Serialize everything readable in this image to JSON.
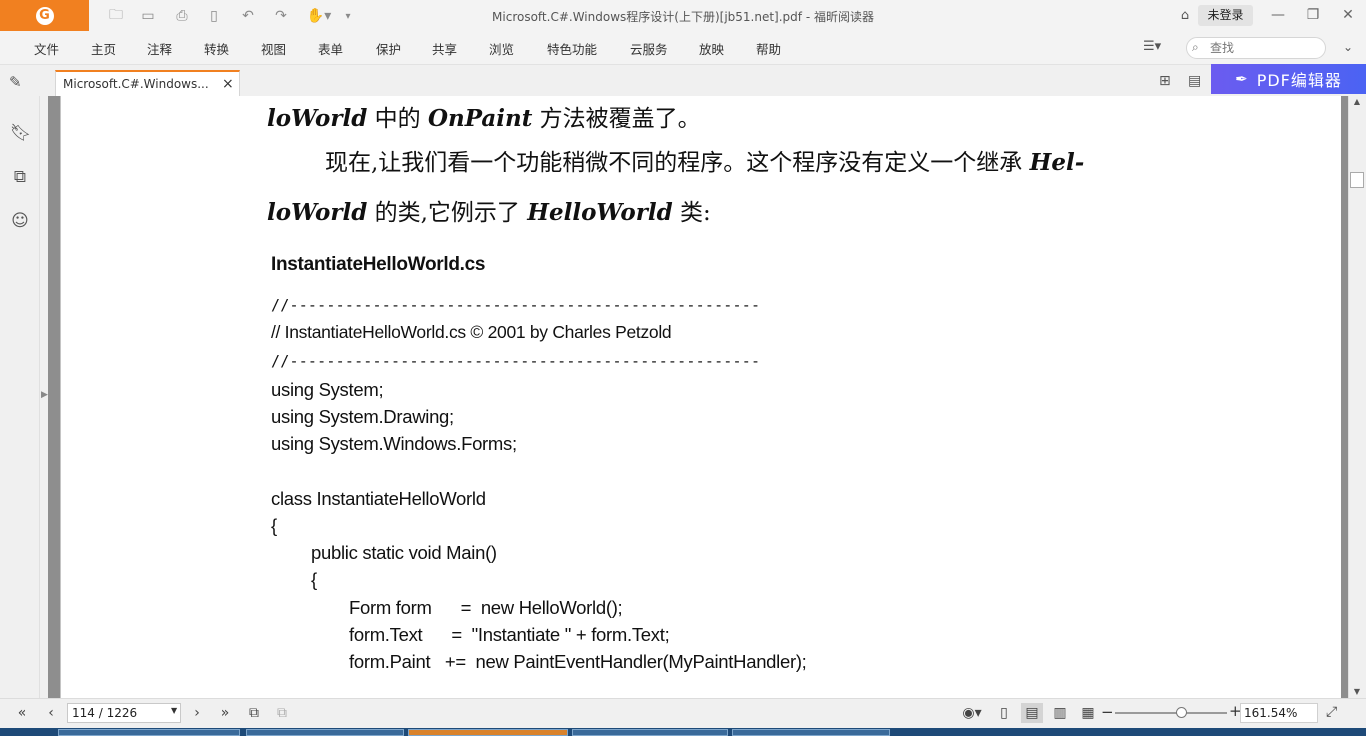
{
  "window": {
    "title": "Microsoft.C#.Windows程序设计(上下册)[jb51.net].pdf - 福昕阅读器",
    "login_label": "未登录"
  },
  "logo": {
    "letter": "G"
  },
  "menu": {
    "items": [
      "文件",
      "主页",
      "注释",
      "转换",
      "视图",
      "表单",
      "保护",
      "共享",
      "浏览",
      "特色功能",
      "云服务",
      "放映",
      "帮助"
    ]
  },
  "search": {
    "placeholder": "查找"
  },
  "tab": {
    "label": "Microsoft.C#.Windows...",
    "close": "×"
  },
  "banner": {
    "label": "PDF编辑器"
  },
  "page": {
    "line1_a": "loWorld",
    "line1_b": " 中的 ",
    "line1_c": "OnPaint",
    "line1_d": " 方法被覆盖了。",
    "line2_a": "现在,让我们看一个功能稍微不同的程序。这个程序没有定义一个继承 ",
    "line2_b": "Hel-",
    "line3_a": "loWorld",
    "line3_b": " 的类,它例示了 ",
    "line3_c": "HelloWorld",
    "line3_d": " 类:",
    "heading": "InstantiateHelloWorld.cs",
    "code": [
      "//---------------------------------------------------",
      "// InstantiateHelloWorld.cs  © 2001 by Charles Petzold",
      "//---------------------------------------------------",
      "using System;",
      "using System.Drawing;",
      "using System.Windows.Forms;",
      "class InstantiateHelloWorld",
      "{",
      "public static void Main()",
      "{",
      "Form form      =  new HelloWorld();",
      "form.Text      =  \"Instantiate \" + form.Text;",
      "form.Paint   +=  new PaintEventHandler(MyPaintHandler);"
    ]
  },
  "status": {
    "page_indicator": "114 / 1226",
    "zoom": "161.54%"
  },
  "colors": {
    "brand_orange": "#f18020",
    "banner_purple": "#5a60f2"
  }
}
